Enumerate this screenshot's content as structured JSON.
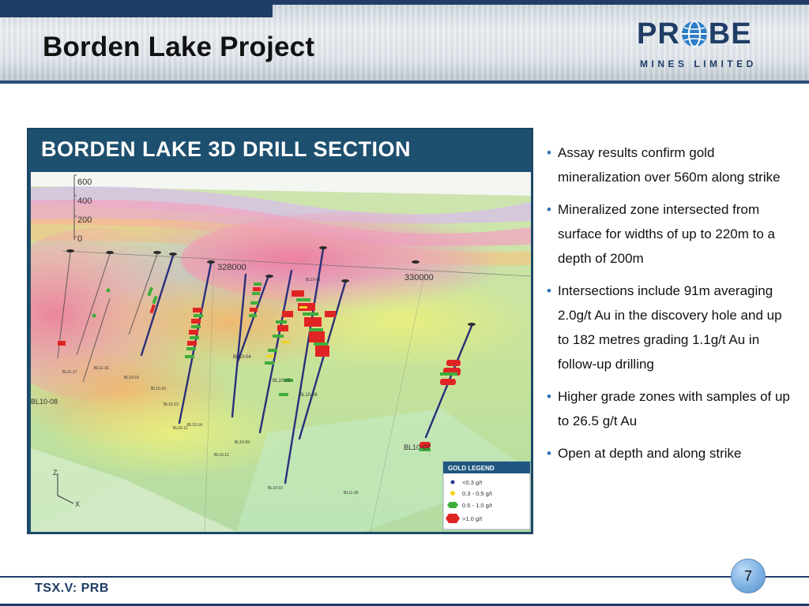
{
  "header": {
    "title": "Borden Lake Project",
    "logo_word_left": "PR",
    "logo_word_right": "BE",
    "logo_sub": "MINES LIMITED"
  },
  "figure": {
    "title": "BORDEN LAKE 3D DRILL SECTION",
    "elevation_ticks": [
      "600",
      "400",
      "200",
      "0"
    ],
    "coordinates": [
      "328000",
      "330000"
    ],
    "holes": [
      "BL10-08",
      "BL10-07",
      "BL10-06",
      "BL10-05",
      "BL10-09",
      "BL10-10",
      "BL10-11",
      "BL10-12",
      "BL10-13",
      "BL10-14",
      "BL10-15",
      "BL10-16",
      "BL11-16",
      "BL11-17",
      "BL10-01",
      "BL11-09",
      "BL10-04"
    ],
    "axes": {
      "z": "Z",
      "x": "X"
    },
    "legend": {
      "title": "GOLD LEGEND",
      "items": [
        {
          "label": "<0.3 g/t",
          "color": "#2b3a8f"
        },
        {
          "label": "0.3 - 0.5 g/t",
          "color": "#f2d31b"
        },
        {
          "label": "0.5 - 1.0 g/t",
          "color": "#3fae3a"
        },
        {
          "label": ">1.0 g/t",
          "color": "#e02424"
        }
      ]
    }
  },
  "bullets": [
    "Assay results confirm gold mineralization over 560m along strike",
    "Mineralized zone intersected from surface for widths of up to 220m to a depth of 200m",
    "Intersections include 91m averaging 2.0g/t Au in the discovery hole and up to 182 metres grading 1.1g/t Au in follow-up drilling",
    "Higher grade zones with samples of up to 26.5 g/t Au",
    "Open at depth and along strike"
  ],
  "footer": {
    "ticker": "TSX.V: PRB",
    "page_number": "7"
  },
  "colors": {
    "brand": "#1f3d66",
    "bullet_dot": "#2f6fb7",
    "figure_header": "#1d4f6e"
  }
}
